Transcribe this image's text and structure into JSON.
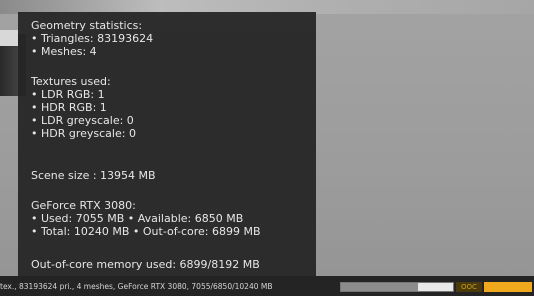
{
  "stats": {
    "geometry_heading": "Geometry statistics:",
    "triangles": "• Triangles: 83193624",
    "meshes": "• Meshes: 4",
    "textures_heading": "Textures used:",
    "ldr_rgb": "• LDR RGB: 1",
    "hdr_rgb": "• HDR RGB: 1",
    "ldr_grey": "• LDR greyscale: 0",
    "hdr_grey": "• HDR greyscale: 0",
    "scene_size": "Scene size : 13954 MB",
    "gpu_heading": "GeForce RTX 3080:",
    "gpu_used": "• Used: 7055 MB • Available: 6850 MB",
    "gpu_total": "• Total: 10240 MB • Out-of-core: 6899 MB",
    "ooc_memory": "Out-of-core memory used: 6899/8192 MB"
  },
  "statusbar": {
    "text": "tex., 83193624 pri., 4 meshes, GeForce RTX 3080, 7055/6850/10240 MB",
    "memory_fraction": 0.69,
    "badge": "OOC",
    "colors": {
      "accent": "#f0a81c",
      "background": "#242424"
    }
  }
}
